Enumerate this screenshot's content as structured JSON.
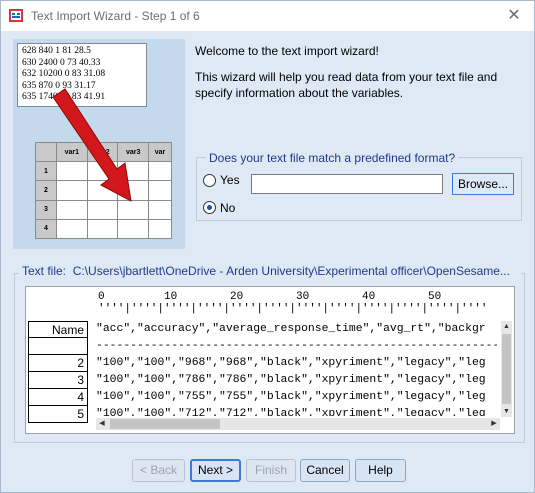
{
  "window": {
    "title": "Text Import Wizard - Step 1 of 6",
    "close_glyph": "✕"
  },
  "illustration": {
    "data_lines": [
      "628 840 1 81 28.5",
      "630 2400 0 73 40.33",
      "632 10200 0 83 31.08",
      "635 870 0 93 31.17",
      "635 17400 0 83 41.91"
    ],
    "sheet_headers": [
      "var1",
      "var2",
      "var3",
      "var"
    ],
    "sheet_rows": [
      "1",
      "2",
      "3",
      "4"
    ],
    "arrow_color": "#d3181b"
  },
  "intro": {
    "welcome": "Welcome to the text import wizard!",
    "description": "This wizard will help you read data from your text file and specify information about the variables."
  },
  "format": {
    "question": "Does your text file match a predefined format?",
    "yes_label": "Yes",
    "no_label": "No",
    "selected": "No",
    "file_value": "",
    "browse_label": "Browse..."
  },
  "textfile": {
    "label": "Text file:",
    "path": "C:\\Users\\jbartlett\\OneDrive - Arden University\\Experimental officer\\OpenSesame...",
    "ruler_numbers": "0         10        20        30        40        50",
    "ruler_dots": "''''|''''|''''|''''|''''|''''|''''|''''|''''|''''|''''|''''",
    "row_labels": [
      "Name",
      "",
      "2",
      "3",
      "4",
      "5"
    ],
    "lines": [
      "\"acc\",\"accuracy\",\"average_response_time\",\"avg_rt\",\"backgr",
      "------------------------------------------------------------",
      "\"100\",\"100\",\"968\",\"968\",\"black\",\"xpyriment\",\"legacy\",\"leg",
      "\"100\",\"100\",\"786\",\"786\",\"black\",\"xpyriment\",\"legacy\",\"leg",
      "\"100\",\"100\",\"755\",\"755\",\"black\",\"xpyriment\",\"legacy\",\"leg",
      "\"100\",\"100\",\"712\",\"712\",\"black\",\"xpyriment\",\"legacy\",\"leg"
    ]
  },
  "buttons": {
    "back": "< Back",
    "next": "Next >",
    "finish": "Finish",
    "cancel": "Cancel",
    "help": "Help"
  },
  "colors": {
    "window_bg": "#dfe9f5",
    "group_title": "#1f3a8a",
    "accent": "#3d7bd0"
  }
}
